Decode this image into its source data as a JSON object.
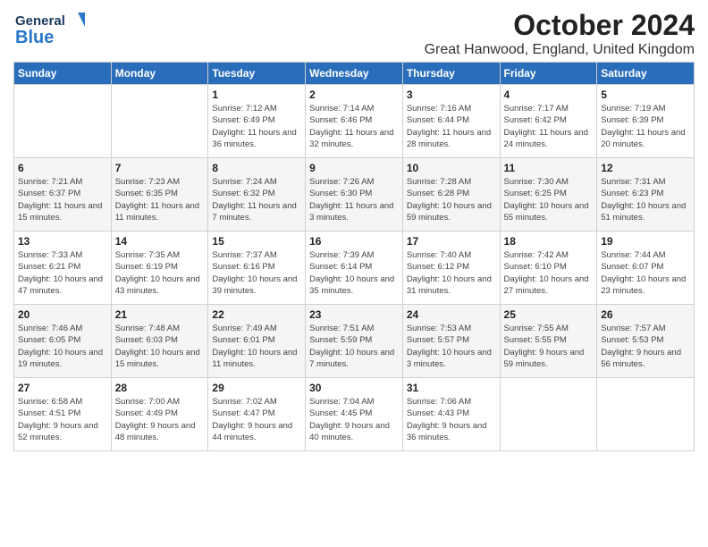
{
  "logo": {
    "line1": "General",
    "line2": "Blue"
  },
  "title": "October 2024",
  "location": "Great Hanwood, England, United Kingdom",
  "days_of_week": [
    "Sunday",
    "Monday",
    "Tuesday",
    "Wednesday",
    "Thursday",
    "Friday",
    "Saturday"
  ],
  "weeks": [
    [
      {
        "day": "",
        "info": ""
      },
      {
        "day": "",
        "info": ""
      },
      {
        "day": "1",
        "info": "Sunrise: 7:12 AM\nSunset: 6:49 PM\nDaylight: 11 hours\nand 36 minutes."
      },
      {
        "day": "2",
        "info": "Sunrise: 7:14 AM\nSunset: 6:46 PM\nDaylight: 11 hours\nand 32 minutes."
      },
      {
        "day": "3",
        "info": "Sunrise: 7:16 AM\nSunset: 6:44 PM\nDaylight: 11 hours\nand 28 minutes."
      },
      {
        "day": "4",
        "info": "Sunrise: 7:17 AM\nSunset: 6:42 PM\nDaylight: 11 hours\nand 24 minutes."
      },
      {
        "day": "5",
        "info": "Sunrise: 7:19 AM\nSunset: 6:39 PM\nDaylight: 11 hours\nand 20 minutes."
      }
    ],
    [
      {
        "day": "6",
        "info": "Sunrise: 7:21 AM\nSunset: 6:37 PM\nDaylight: 11 hours\nand 15 minutes."
      },
      {
        "day": "7",
        "info": "Sunrise: 7:23 AM\nSunset: 6:35 PM\nDaylight: 11 hours\nand 11 minutes."
      },
      {
        "day": "8",
        "info": "Sunrise: 7:24 AM\nSunset: 6:32 PM\nDaylight: 11 hours\nand 7 minutes."
      },
      {
        "day": "9",
        "info": "Sunrise: 7:26 AM\nSunset: 6:30 PM\nDaylight: 11 hours\nand 3 minutes."
      },
      {
        "day": "10",
        "info": "Sunrise: 7:28 AM\nSunset: 6:28 PM\nDaylight: 10 hours\nand 59 minutes."
      },
      {
        "day": "11",
        "info": "Sunrise: 7:30 AM\nSunset: 6:25 PM\nDaylight: 10 hours\nand 55 minutes."
      },
      {
        "day": "12",
        "info": "Sunrise: 7:31 AM\nSunset: 6:23 PM\nDaylight: 10 hours\nand 51 minutes."
      }
    ],
    [
      {
        "day": "13",
        "info": "Sunrise: 7:33 AM\nSunset: 6:21 PM\nDaylight: 10 hours\nand 47 minutes."
      },
      {
        "day": "14",
        "info": "Sunrise: 7:35 AM\nSunset: 6:19 PM\nDaylight: 10 hours\nand 43 minutes."
      },
      {
        "day": "15",
        "info": "Sunrise: 7:37 AM\nSunset: 6:16 PM\nDaylight: 10 hours\nand 39 minutes."
      },
      {
        "day": "16",
        "info": "Sunrise: 7:39 AM\nSunset: 6:14 PM\nDaylight: 10 hours\nand 35 minutes."
      },
      {
        "day": "17",
        "info": "Sunrise: 7:40 AM\nSunset: 6:12 PM\nDaylight: 10 hours\nand 31 minutes."
      },
      {
        "day": "18",
        "info": "Sunrise: 7:42 AM\nSunset: 6:10 PM\nDaylight: 10 hours\nand 27 minutes."
      },
      {
        "day": "19",
        "info": "Sunrise: 7:44 AM\nSunset: 6:07 PM\nDaylight: 10 hours\nand 23 minutes."
      }
    ],
    [
      {
        "day": "20",
        "info": "Sunrise: 7:46 AM\nSunset: 6:05 PM\nDaylight: 10 hours\nand 19 minutes."
      },
      {
        "day": "21",
        "info": "Sunrise: 7:48 AM\nSunset: 6:03 PM\nDaylight: 10 hours\nand 15 minutes."
      },
      {
        "day": "22",
        "info": "Sunrise: 7:49 AM\nSunset: 6:01 PM\nDaylight: 10 hours\nand 11 minutes."
      },
      {
        "day": "23",
        "info": "Sunrise: 7:51 AM\nSunset: 5:59 PM\nDaylight: 10 hours\nand 7 minutes."
      },
      {
        "day": "24",
        "info": "Sunrise: 7:53 AM\nSunset: 5:57 PM\nDaylight: 10 hours\nand 3 minutes."
      },
      {
        "day": "25",
        "info": "Sunrise: 7:55 AM\nSunset: 5:55 PM\nDaylight: 9 hours\nand 59 minutes."
      },
      {
        "day": "26",
        "info": "Sunrise: 7:57 AM\nSunset: 5:53 PM\nDaylight: 9 hours\nand 56 minutes."
      }
    ],
    [
      {
        "day": "27",
        "info": "Sunrise: 6:58 AM\nSunset: 4:51 PM\nDaylight: 9 hours\nand 52 minutes."
      },
      {
        "day": "28",
        "info": "Sunrise: 7:00 AM\nSunset: 4:49 PM\nDaylight: 9 hours\nand 48 minutes."
      },
      {
        "day": "29",
        "info": "Sunrise: 7:02 AM\nSunset: 4:47 PM\nDaylight: 9 hours\nand 44 minutes."
      },
      {
        "day": "30",
        "info": "Sunrise: 7:04 AM\nSunset: 4:45 PM\nDaylight: 9 hours\nand 40 minutes."
      },
      {
        "day": "31",
        "info": "Sunrise: 7:06 AM\nSunset: 4:43 PM\nDaylight: 9 hours\nand 36 minutes."
      },
      {
        "day": "",
        "info": ""
      },
      {
        "day": "",
        "info": ""
      }
    ]
  ]
}
